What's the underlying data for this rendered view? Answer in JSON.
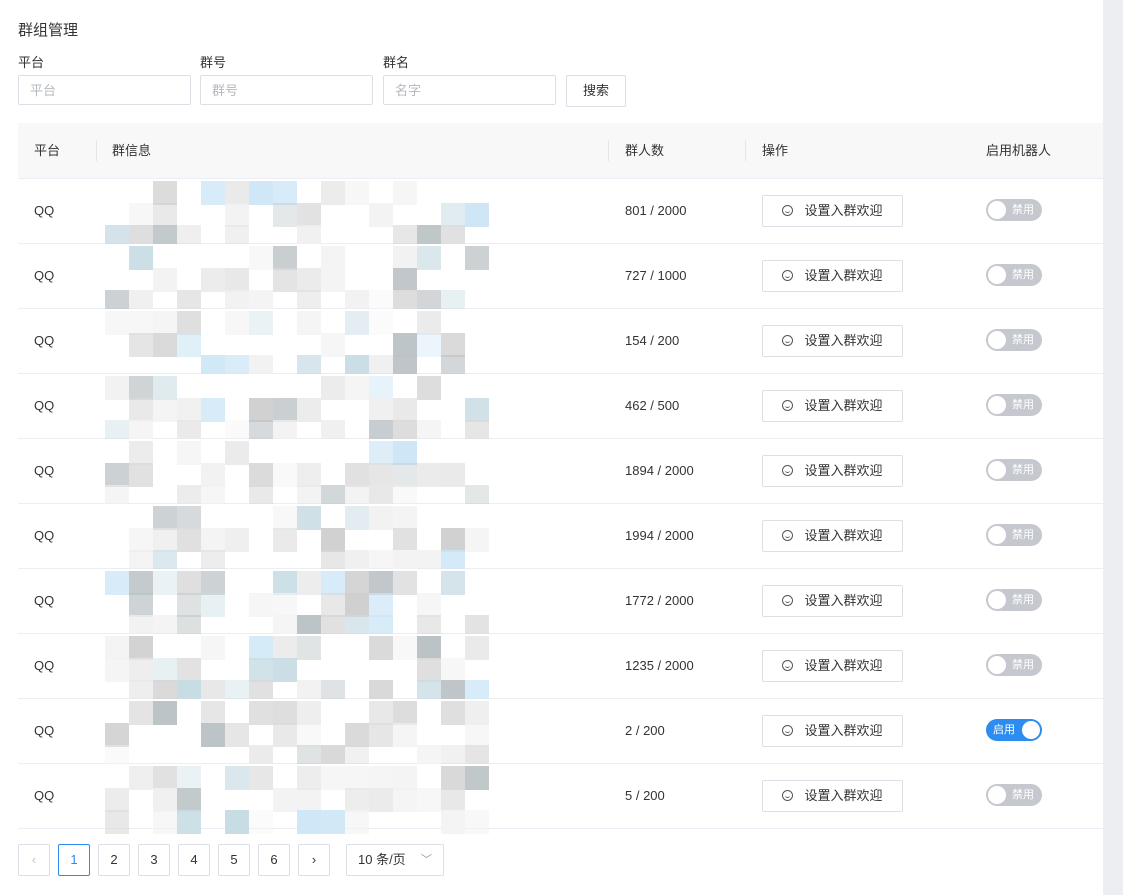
{
  "page": {
    "title": "群组管理"
  },
  "filters": {
    "platform": {
      "label": "平台",
      "placeholder": "平台",
      "value": ""
    },
    "group_id": {
      "label": "群号",
      "placeholder": "群号",
      "value": ""
    },
    "group_name": {
      "label": "群名",
      "placeholder": "名字",
      "value": ""
    },
    "search_label": "搜索"
  },
  "table": {
    "columns": [
      "平台",
      "群信息",
      "群人数",
      "操作",
      "启用机器人"
    ],
    "welcome_label": "设置入群欢迎",
    "rows": [
      {
        "platform": "QQ",
        "members": "801 / 2000",
        "bot_enabled": false,
        "toggle_label": "禁用"
      },
      {
        "platform": "QQ",
        "members": "727 / 1000",
        "bot_enabled": false,
        "toggle_label": "禁用"
      },
      {
        "platform": "QQ",
        "members": "154 / 200",
        "bot_enabled": false,
        "toggle_label": "禁用"
      },
      {
        "platform": "QQ",
        "members": "462 / 500",
        "bot_enabled": false,
        "toggle_label": "禁用"
      },
      {
        "platform": "QQ",
        "members": "1894 / 2000",
        "bot_enabled": false,
        "toggle_label": "禁用"
      },
      {
        "platform": "QQ",
        "members": "1994 / 2000",
        "bot_enabled": false,
        "toggle_label": "禁用"
      },
      {
        "platform": "QQ",
        "members": "1772 / 2000",
        "bot_enabled": false,
        "toggle_label": "禁用"
      },
      {
        "platform": "QQ",
        "members": "1235 / 2000",
        "bot_enabled": false,
        "toggle_label": "禁用"
      },
      {
        "platform": "QQ",
        "members": "2 / 200",
        "bot_enabled": true,
        "toggle_label": "启用"
      },
      {
        "platform": "QQ",
        "members": "5 / 200",
        "bot_enabled": false,
        "toggle_label": "禁用"
      }
    ]
  },
  "pagination": {
    "prev_icon": "chevron-left-icon",
    "next_icon": "chevron-right-icon",
    "pages": [
      "1",
      "2",
      "3",
      "4",
      "5",
      "6"
    ],
    "current_page": "1",
    "page_size_label": "10 条/页"
  },
  "colors": {
    "accent": "#2d8cf0",
    "toggle_off": "#c5c8ce"
  }
}
